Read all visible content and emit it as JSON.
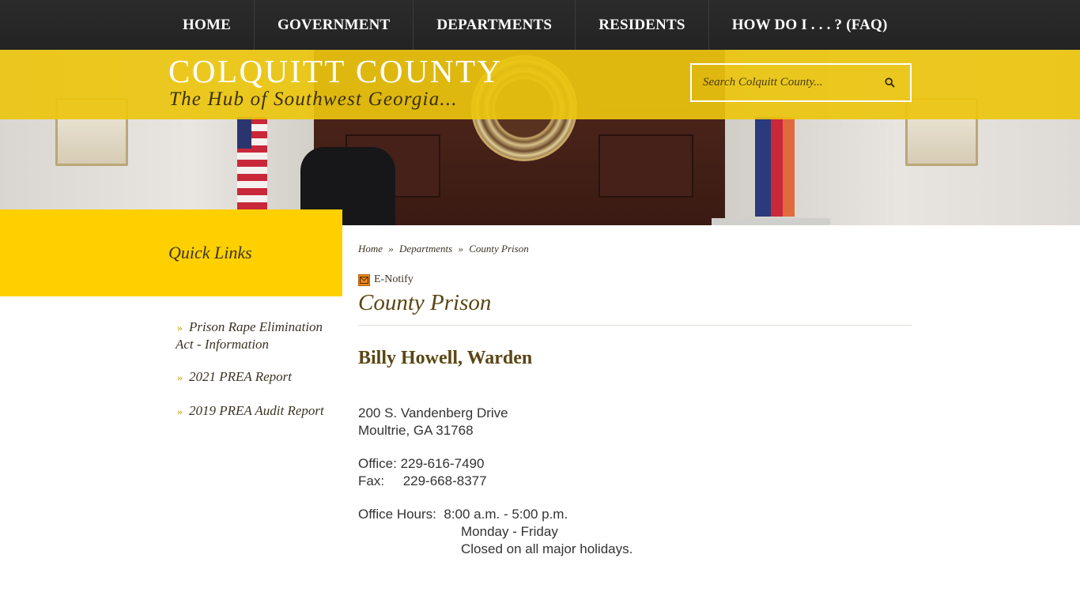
{
  "nav": {
    "items": [
      "HOME",
      "GOVERNMENT",
      "DEPARTMENTS",
      "RESIDENTS",
      "HOW DO I . . . ? (FAQ)"
    ]
  },
  "site": {
    "title": "COLQUITT COUNTY",
    "tagline": "The Hub of Southwest Georgia...",
    "colors": {
      "accent": "#ffd000",
      "header_band": "#ecc50e",
      "nav_bg": "#262626",
      "title_text": "#5a4614"
    }
  },
  "search": {
    "placeholder": "Search Colquitt County...",
    "icon": "search-icon"
  },
  "sidebar": {
    "heading": "Quick Links",
    "items": [
      "Prison Rape Elimination Act - Information",
      "2021 PREA Report",
      "2019 PREA Audit Report"
    ]
  },
  "breadcrumb": {
    "home": "Home",
    "departments": "Departments",
    "current": "County Prison",
    "separator": "»"
  },
  "enotify": {
    "label": "E-Notify",
    "icon": "mail-icon"
  },
  "page": {
    "title": "County Prison",
    "warden": "Billy Howell, Warden",
    "address_line1": "200 S. Vandenberg Drive",
    "address_line2": "Moultrie, GA 31768",
    "office_label": "Office:",
    "office_phone": "229-616-7490",
    "fax_label": "Fax:",
    "fax_phone": "229-668-8377",
    "hours_label": "Office Hours:",
    "hours_time": "8:00 a.m. - 5:00 p.m.",
    "hours_days": "Monday - Friday",
    "hours_note": "Closed on all major holidays."
  }
}
